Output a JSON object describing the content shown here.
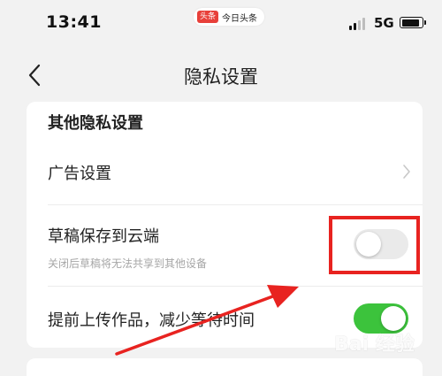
{
  "status_bar": {
    "time": "13:41",
    "app_badge": "头条",
    "app_name": "今日头条",
    "network": "5G"
  },
  "nav": {
    "title": "隐私设置"
  },
  "card": {
    "section_title": "其他隐私设置",
    "rows": [
      {
        "label": "广告设置"
      },
      {
        "label": "草稿保存到云端",
        "sublabel": "关闭后草稿将无法共享到其他设备",
        "toggle_state": "off"
      },
      {
        "label": "提前上传作品，减少等待时间",
        "toggle_state": "on"
      }
    ]
  },
  "colors": {
    "toggle_on": "#3cc33c",
    "toggle_off": "#eaeaea",
    "annotation": "#e82320"
  },
  "watermark": {
    "text": "Bai 经验"
  }
}
